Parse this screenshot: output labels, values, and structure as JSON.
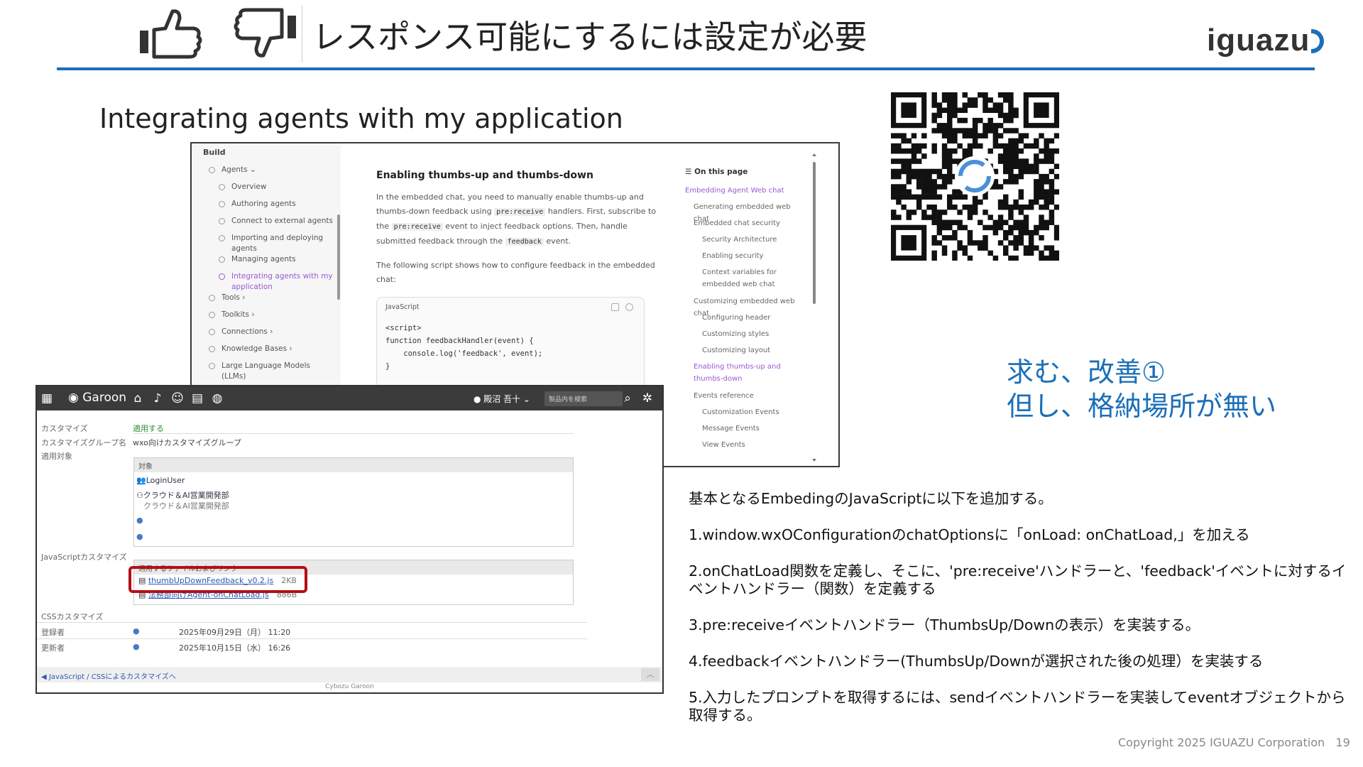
{
  "header": {
    "title": "レスポンス可能にするには設定が必要",
    "logo_text": "iguazu",
    "icons": [
      "thumbs-up-icon",
      "thumbs-down-icon"
    ],
    "accent_color": "#1b6fb8"
  },
  "subtitle": "Integrating agents with my application",
  "docs": {
    "sidebar_section": "Build",
    "sidebar_items": [
      {
        "label": "Agents ⌄",
        "level": 0
      },
      {
        "label": "Overview",
        "level": 1
      },
      {
        "label": "Authoring agents",
        "level": 1
      },
      {
        "label": "Connect to external agents",
        "level": 1
      },
      {
        "label": "Importing and deploying agents",
        "level": 1
      },
      {
        "label": "Managing agents",
        "level": 1
      },
      {
        "label": "Integrating agents with my application",
        "level": 1,
        "active": true
      },
      {
        "label": "Tools ›",
        "level": 0
      },
      {
        "label": "Toolkits ›",
        "level": 0
      },
      {
        "label": "Connections ›",
        "level": 0
      },
      {
        "label": "Knowledge Bases ›",
        "level": 0
      },
      {
        "label": "Large Language Models (LLMs)",
        "level": 0
      }
    ],
    "heading": "Enabling thumbs-up and thumbs-down",
    "para1_a": "In the embedded chat, you need to manually enable thumbs-up and thumbs-down feedback using",
    "para1_code1": "pre:receive",
    "para1_b": "handlers. First, subscribe to the",
    "para1_code2": "pre:receive",
    "para1_c": "event to inject feedback options. Then, handle submitted feedback through the",
    "para1_code3": "feedback",
    "para1_d": "event.",
    "para2": "The following script shows how to configure feedback in the embedded chat:",
    "code_lang": "JavaScript",
    "code": "<script>\nfunction feedbackHandler(event) {\n    console.log('feedback', event);\n}",
    "toc_title": "☰ On this page",
    "toc": [
      {
        "label": "Embedding Agent Web chat",
        "level": 0,
        "active": true
      },
      {
        "label": "Generating embedded web chat",
        "level": 1
      },
      {
        "label": "Embedded chat security",
        "level": 1
      },
      {
        "label": "Security Architecture",
        "level": 2
      },
      {
        "label": "Enabling security",
        "level": 2
      },
      {
        "label": "Context variables for embedded web chat",
        "level": 2
      },
      {
        "label": "Customizing embedded web chat",
        "level": 1
      },
      {
        "label": "Configuring header",
        "level": 2
      },
      {
        "label": "Customizing styles",
        "level": 2
      },
      {
        "label": "Customizing layout",
        "level": 2
      },
      {
        "label": "Enabling thumbs-up and thumbs-down",
        "level": 1,
        "active": true
      },
      {
        "label": "Events reference",
        "level": 1
      },
      {
        "label": "Customization Events",
        "level": 2
      },
      {
        "label": "Message Events",
        "level": 2
      },
      {
        "label": "View Events",
        "level": 2
      }
    ]
  },
  "garoon": {
    "brand": "Garoon",
    "user": "殿沼 吾十 ⌄",
    "search_placeholder": "製品内を検索",
    "rows": {
      "customize_label": "カスタマイズ",
      "customize_value": "適用する",
      "group_label": "カスタマイズグループ名",
      "group_value": "wxo向けカスタマイズグループ",
      "target_label": "適用対象",
      "target_header": "対象",
      "targets": [
        "LoginUser",
        "クラウド＆AI営業開発部",
        "クラウド＆AI営業開発部"
      ],
      "js_label": "JavaScriptカスタマイズ",
      "js_header": "適用するファイルおよびリンク",
      "js_file1": "thumbUpDownFeedback_v0.2.js",
      "js_file1_size": "2KB",
      "js_file2": "法務部向けAgent-onChatLoad.js",
      "js_file2_size": "886B",
      "css_label": "CSSカスタマイズ",
      "created_label": "登録者",
      "created_value": "2025年09月29日（月） 11:20",
      "updated_label": "更新者",
      "updated_value": "2025年10月15日（水） 16:26"
    },
    "footer_link": "JavaScript / CSSによるカスタマイズへ",
    "copyright": "Cybozu Garoon"
  },
  "note_blue": [
    "求む、改善①",
    "但し、格納場所が無い"
  ],
  "steps": [
    "基本となるEmbedingのJavaScriptに以下を追加する。",
    "1.window.wxOConfigurationのchatOptionsに「onLoad: onChatLoad,」を加える",
    "2.onChatLoad関数を定義し、そこに、'pre:receive'ハンドラーと、'feedback'イベントに対するイベントハンドラー（関数）を定義する",
    "3.pre:receiveイベントハンドラー（ThumbsUp/Downの表示）を実装する。",
    "4.feedbackイベントハンドラー(ThumbsUp/Downが選択された後の処理）を実装する",
    "5.入力したプロンプトを取得するには、sendイベントハンドラーを実装してeventオブジェクトから取得する。"
  ],
  "footer": {
    "copyright": "Copyright 2025 IGUAZU Corporation",
    "page": "19"
  }
}
